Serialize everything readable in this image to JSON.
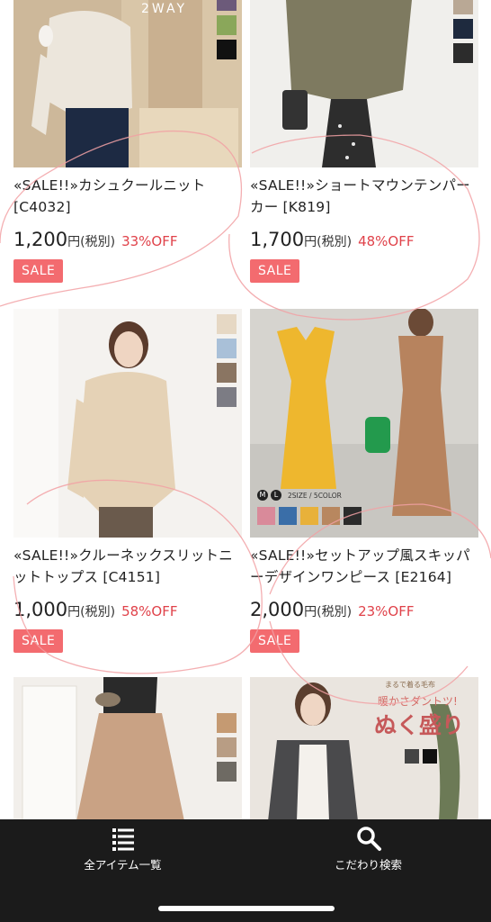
{
  "products": [
    {
      "title": "«SALE!!»カシュクールニット [C4032]",
      "price": "1,200",
      "yen": "円",
      "tax": "(税別)",
      "discount": "33%OFF",
      "badge": "SALE",
      "photo_text": "2WAY",
      "swatches": [
        "#6c5a7a",
        "#8aa75a",
        "#111111"
      ]
    },
    {
      "title": "«SALE!!»ショートマウンテンパーカー [K819]",
      "price": "1,700",
      "yen": "円",
      "tax": "(税別)",
      "discount": "48%OFF",
      "badge": "SALE",
      "swatches": [
        "#b9a895",
        "#1e2a3e",
        "#2c2c2c"
      ]
    },
    {
      "title": "«SALE!!»クルーネックスリットニットトップス [C4151]",
      "price": "1,000",
      "yen": "円",
      "tax": "(税別)",
      "discount": "58%OFF",
      "badge": "SALE",
      "swatches": [
        "#e6d8c4",
        "#a9c0d8",
        "#8a7562",
        "#7c7c84"
      ]
    },
    {
      "title": "«SALE!!»セットアップ風スキッパーデザインワンピース [E2164]",
      "price": "2,000",
      "yen": "円",
      "tax": "(税別)",
      "discount": "23%OFF",
      "badge": "SALE",
      "photo_text": "2SIZE / 5COLOR",
      "size_labels": [
        "M",
        "L"
      ],
      "swatches": [
        "#d98a9a",
        "#3a6ea8",
        "#e8b13a",
        "#b8875f",
        "#2b2b2b"
      ]
    },
    {
      "title": "",
      "swatches": [
        "#c59a72",
        "#b89d84",
        "#6e6a63"
      ]
    },
    {
      "title": "",
      "photo_text_1": "まるで着る毛布",
      "photo_text_2": "暖かさダントツ!",
      "photo_text_3": "ぬく盛り",
      "swatches": [
        "#444444",
        "#111111"
      ]
    }
  ],
  "tabbar": {
    "all_items_label": "全アイテム一覧",
    "search_label": "こだわり検索",
    "all_items_icon": "list-icon",
    "search_icon": "search-icon"
  },
  "colors": {
    "discount": "#e0424a",
    "sale_badge": "#f36b6f",
    "tabbar": "#1b1b1b",
    "scribble": "#f2a1a4"
  }
}
